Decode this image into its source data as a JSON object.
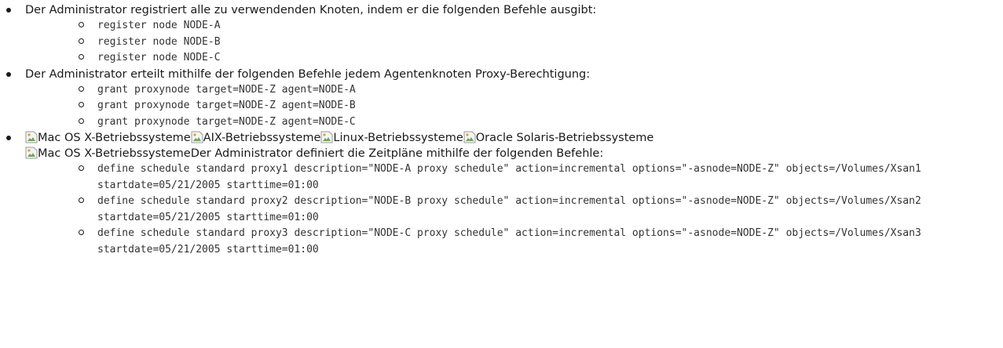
{
  "items": [
    {
      "text": "Der Administrator registriert alle zu verwendenden Knoten, indem er die folgenden Befehle ausgibt:",
      "commands": [
        "register node NODE-A",
        "register node NODE-B",
        "register node NODE-C"
      ]
    },
    {
      "text": "Der Administrator erteilt mithilfe der folgenden Befehle jedem Agentenknoten Proxy-Berechtigung:",
      "commands": [
        "grant proxynode target=NODE-Z agent=NODE-A",
        "grant proxynode target=NODE-Z agent=NODE-B",
        "grant proxynode target=NODE-Z agent=NODE-C"
      ]
    },
    {
      "os_labels": [
        "Mac OS X-Betriebssysteme",
        "AIX-Betriebssysteme",
        "Linux-Betriebssysteme",
        "Oracle Solaris-Betriebssysteme"
      ],
      "second_os_label": "Mac OS X-Betriebssysteme",
      "text": "Der Administrator definiert die Zeitpläne mithilfe der folgenden Befehle:",
      "commands": [
        "define schedule standard proxy1 description=\"NODE-A proxy schedule\" action=incremental options=\"-asnode=NODE-Z\" objects=/Volumes/Xsan1 startdate=05/21/2005 starttime=01:00",
        "define schedule standard proxy2 description=\"NODE-B proxy schedule\" action=incremental options=\"-asnode=NODE-Z\" objects=/Volumes/Xsan2 startdate=05/21/2005 starttime=01:00",
        "define schedule standard proxy3 description=\"NODE-C proxy schedule\" action=incremental options=\"-asnode=NODE-Z\" objects=/Volumes/Xsan3 startdate=05/21/2005 starttime=01:00"
      ]
    }
  ]
}
